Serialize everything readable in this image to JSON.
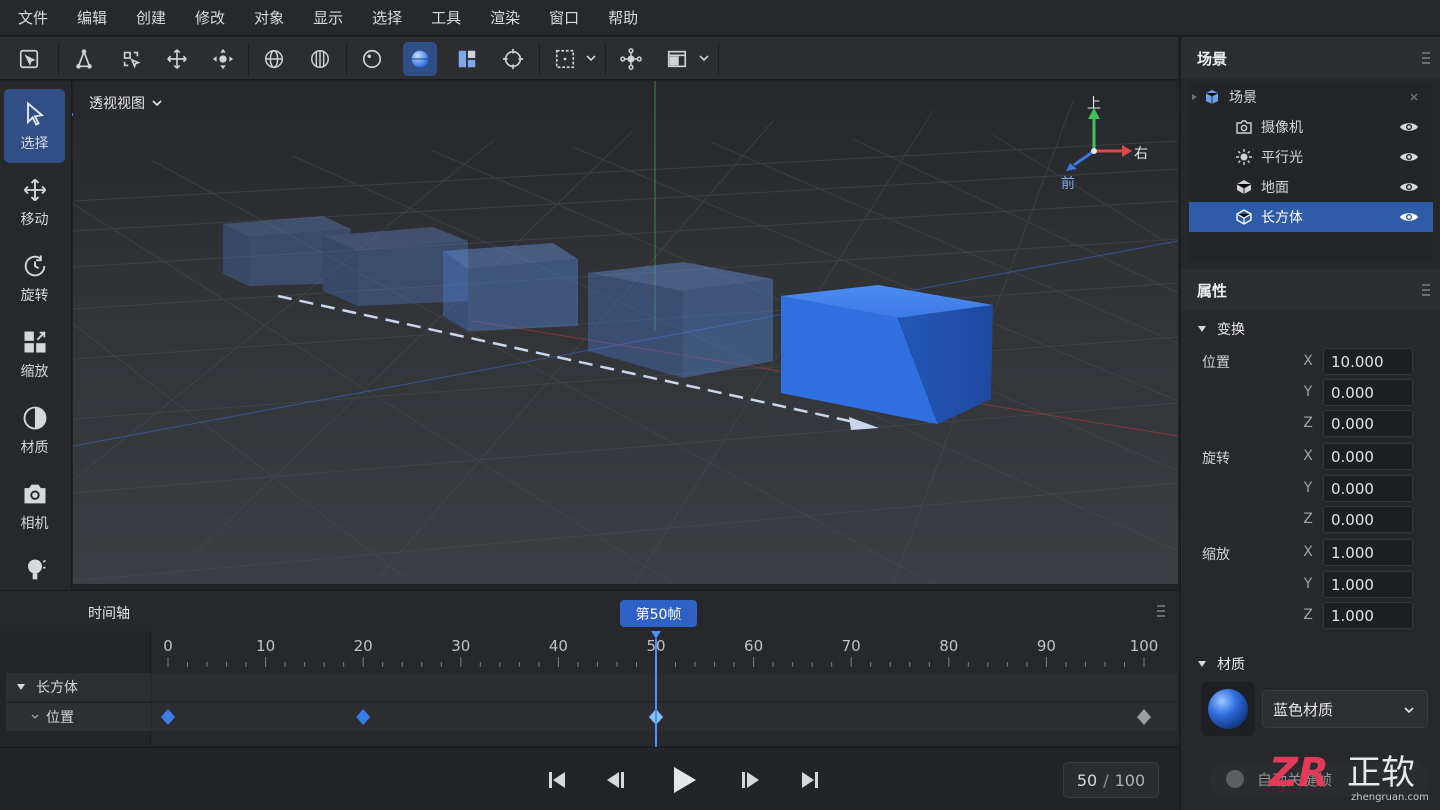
{
  "menu": [
    "文件",
    "编辑",
    "创建",
    "修改",
    "对象",
    "显示",
    "选择",
    "工具",
    "渲染",
    "窗口",
    "帮助"
  ],
  "toolbar": {
    "icons": [
      "frame-select-icon",
      "select-tool-icon",
      "box-select-icon",
      "move-icon",
      "transform-icon",
      "wireframe-sphere-icon",
      "wireframe-cylinder-icon",
      "outline-circle-icon",
      "shaded-sphere-icon",
      "layout-icon",
      "snap-icon",
      "region-select-icon",
      "network-icon",
      "window-layout-icon"
    ],
    "active": "shaded-sphere-icon"
  },
  "left_tools": [
    {
      "label": "选择",
      "icon": "cursor-icon",
      "active": true
    },
    {
      "label": "移动",
      "icon": "move-arrows-icon",
      "active": false
    },
    {
      "label": "旋转",
      "icon": "rotate-icon",
      "active": false
    },
    {
      "label": "缩放",
      "icon": "scale-icon",
      "active": false
    },
    {
      "label": "材质",
      "icon": "material-icon",
      "active": false
    },
    {
      "label": "相机",
      "icon": "camera-icon",
      "active": false
    },
    {
      "label": "灯光",
      "icon": "light-icon",
      "active": false
    }
  ],
  "viewport": {
    "view_name": "透视视图",
    "gizmo": {
      "up": "上",
      "right": "右",
      "front": "前"
    }
  },
  "timeline": {
    "title": "时间轴",
    "current_frame_badge": "第50帧",
    "current_frame": 50,
    "ticks": [
      "0",
      "10",
      "20",
      "30",
      "40",
      "50",
      "60",
      "70",
      "80",
      "90",
      "100"
    ],
    "tracks": {
      "object": "长方体",
      "property": "位置"
    },
    "keyframes": [
      0,
      20,
      50,
      100
    ]
  },
  "playback": {
    "current": "50",
    "separator": "/",
    "total": "100",
    "auto_key_label": "自动关键帧"
  },
  "scene_panel": {
    "title": "场景",
    "root": "场景",
    "items": [
      {
        "label": "摄像机",
        "icon": "camera-icon",
        "selected": false
      },
      {
        "label": "平行光",
        "icon": "sun-icon",
        "selected": false
      },
      {
        "label": "地面",
        "icon": "plane-icon",
        "selected": false
      },
      {
        "label": "长方体",
        "icon": "cube-icon",
        "selected": true
      }
    ]
  },
  "properties": {
    "title": "属性",
    "transform_title": "变换",
    "position_label": "位置",
    "rotation_label": "旋转",
    "scale_label": "缩放",
    "axes": [
      "X",
      "Y",
      "Z"
    ],
    "position": [
      "10.000",
      "0.000",
      "0.000"
    ],
    "rotation": [
      "0.000",
      "0.000",
      "0.000"
    ],
    "scale": [
      "1.000",
      "1.000",
      "1.000"
    ],
    "material_title": "材质",
    "material_name": "蓝色材质"
  },
  "watermark": {
    "brand": "正软",
    "url": "zhengruan.com"
  },
  "colors": {
    "accent": "#2f62c6",
    "cube": "#2f6fe0",
    "panel": "#26282c"
  }
}
